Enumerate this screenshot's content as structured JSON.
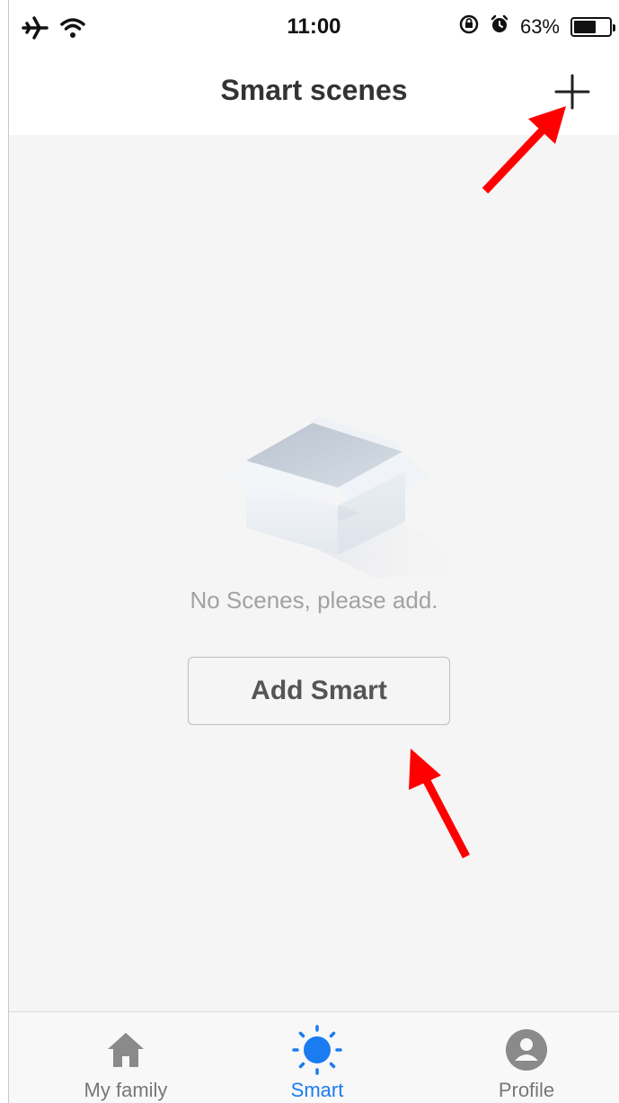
{
  "status_bar": {
    "time": "11:00",
    "battery_percent": "63%",
    "battery_level": 0.63,
    "icons": [
      "airplane-icon",
      "wifi-icon",
      "orientation-lock-icon",
      "alarm-icon",
      "battery-icon"
    ]
  },
  "header": {
    "title": "Smart scenes",
    "add_icon": "plus-icon"
  },
  "empty_state": {
    "illustration": "empty-box-icon",
    "message": "No Scenes, please add.",
    "button_label": "Add Smart"
  },
  "tab_bar": {
    "tabs": [
      {
        "label": "My family",
        "icon": "home-icon",
        "active": false
      },
      {
        "label": "Smart",
        "icon": "sun-icon",
        "active": true
      },
      {
        "label": "Profile",
        "icon": "profile-icon",
        "active": false
      }
    ]
  },
  "colors": {
    "accent": "#1a7cf0",
    "background": "#f5f5f5",
    "annotation_arrow": "#ff0000"
  }
}
